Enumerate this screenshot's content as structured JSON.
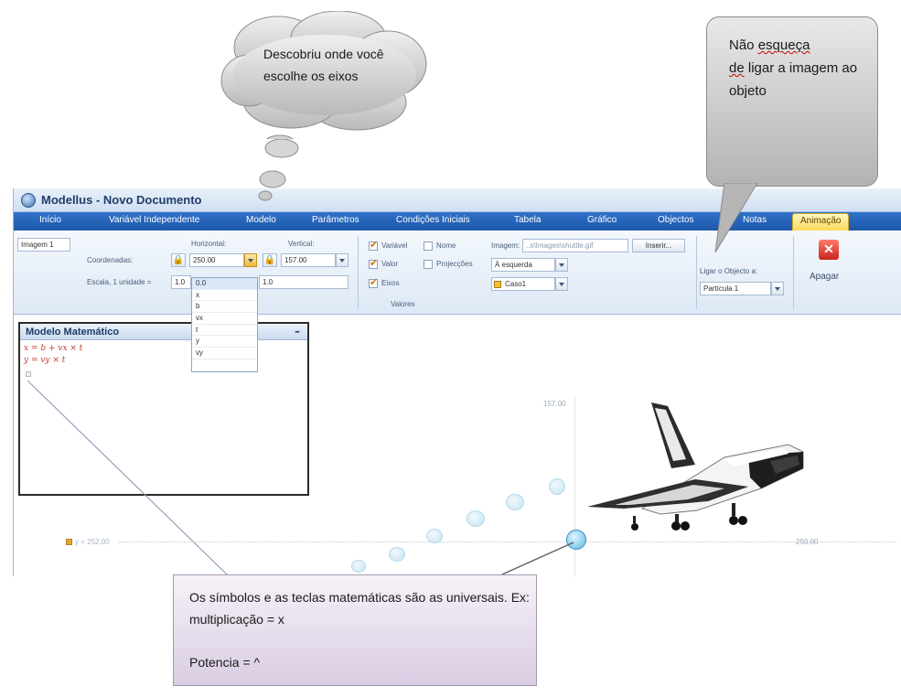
{
  "window": {
    "title": "Modellus - Novo Documento"
  },
  "menu": [
    {
      "label": "Início",
      "active": false
    },
    {
      "label": "Variável Independente",
      "active": false
    },
    {
      "label": "Modelo",
      "active": false
    },
    {
      "label": "Parâmetros",
      "active": false
    },
    {
      "label": "Condições Iniciais",
      "active": false
    },
    {
      "label": "Tabela",
      "active": false
    },
    {
      "label": "Gráfico",
      "active": false
    },
    {
      "label": "Objectos",
      "active": false
    },
    {
      "label": "Notas",
      "active": false
    },
    {
      "label": "Animação",
      "active": true
    }
  ],
  "ribbon": {
    "object_name": "Imagem 1",
    "coord_label": "Coordenadas:",
    "scale_label": "Escala, 1 unidade =",
    "horizontal_label": "Horizontal:",
    "vertical_label": "Vertical:",
    "horizontal_value": "250.00",
    "vertical_value": "157.00",
    "scale_h": "1.0",
    "scale_v": "1.0",
    "lock_glyph": "🔒",
    "chk_variavel": "Variável",
    "chk_nome": "Nome",
    "chk_valor": "Valor",
    "chk_projeccoes": "Projecções",
    "chk_eixos": "Eixos",
    "valores_label": "Valores",
    "imagem_label": "Imagem:",
    "imagem_path": "..s\\Images\\shuttle.gif",
    "inserir_label": "Inserir...",
    "position_select": "À esquerda",
    "case_select": "Caso1",
    "ligar_label": "Ligar o Objecto a:",
    "ligar_select": "Partícula 1",
    "apagar_label": "Apagar",
    "apagar_glyph": "✕"
  },
  "dropdown_options": [
    "0.0",
    "x",
    "b",
    "vx",
    "t",
    "y",
    "vy"
  ],
  "model_panel": {
    "title": "Modelo Matemático",
    "minimize": "–",
    "eq1": "x = b + vx × t",
    "eq2": "y = vy × t"
  },
  "graph": {
    "y_tick": "157.00",
    "x_tick": "250.00",
    "var_label": "y = 252.00"
  },
  "callouts": {
    "cloud_text": "Descobriu onde você escolhe os eixos",
    "bubble2_word1": "Não",
    "bubble2_word2": "esqueça",
    "bubble2_word3": "de",
    "bubble2_rest": "ligar a imagem ao objeto",
    "bubble3_line1": "Os símbolos e as teclas matemáticas são as universais. Ex: multiplicação = x",
    "bubble3_line2": "Potencia = ^"
  },
  "colors": {
    "menu_blue": "#2f72c9",
    "active_tab": "#ffd95a",
    "equation_red": "#c0392b",
    "ball": "#5cb7e4"
  }
}
